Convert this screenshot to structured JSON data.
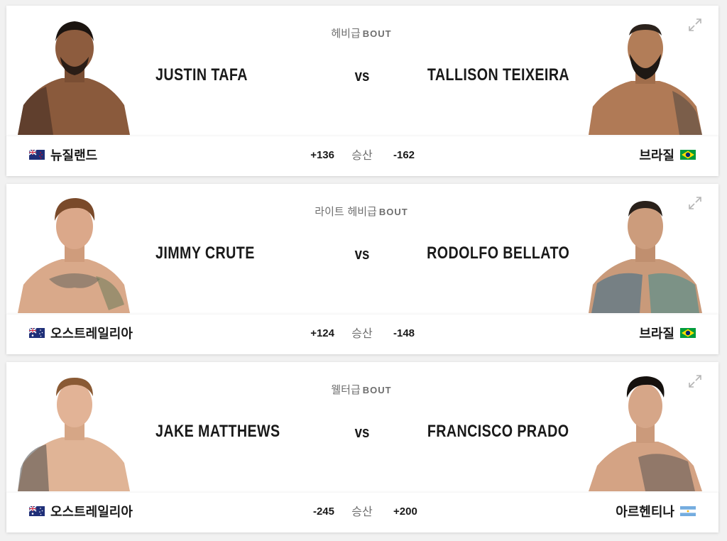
{
  "bout_word": "BOUT",
  "vs_label": "vs",
  "win_label": "승산",
  "fights": [
    {
      "weight_class": "헤비급",
      "red": {
        "name": "JUSTIN TAFA",
        "country": "뉴질랜드",
        "flag": "new-zealand-flag",
        "odds": "+136"
      },
      "blue": {
        "name": "TALLISON TEIXEIRA",
        "country": "브라질",
        "flag": "brazil-flag",
        "odds": "-162"
      }
    },
    {
      "weight_class": "라이트 헤비급",
      "red": {
        "name": "JIMMY CRUTE",
        "country": "오스트레일리아",
        "flag": "australia-flag",
        "odds": "+124"
      },
      "blue": {
        "name": "RODOLFO BELLATO",
        "country": "브라질",
        "flag": "brazil-flag",
        "odds": "-148"
      }
    },
    {
      "weight_class": "웰터급",
      "red": {
        "name": "JAKE MATTHEWS",
        "country": "오스트레일리아",
        "flag": "australia-flag",
        "odds": "-245"
      },
      "blue": {
        "name": "FRANCISCO PRADO",
        "country": "아르헨티나",
        "flag": "argentina-flag",
        "odds": "+200"
      }
    }
  ],
  "colors": {
    "card_bg": "#ffffff",
    "page_bg": "#f1f1f1",
    "text_primary": "#191919",
    "text_muted": "#6e6e6e"
  }
}
